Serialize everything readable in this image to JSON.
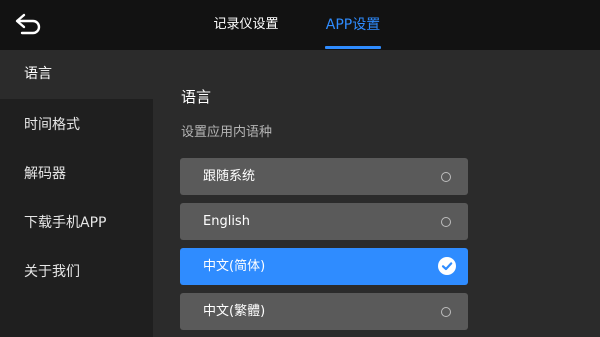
{
  "header": {
    "back_icon": "back-arrow-icon",
    "tabs": [
      {
        "label": "记录仪设置",
        "active": false
      },
      {
        "label": "APP设置",
        "active": true
      }
    ],
    "accent_color": "#2f8cff"
  },
  "sidebar": {
    "items": [
      {
        "label": "语言",
        "active": true
      },
      {
        "label": "时间格式",
        "active": false
      },
      {
        "label": "解码器",
        "active": false
      },
      {
        "label": "下载手机APP",
        "active": false
      },
      {
        "label": "关于我们",
        "active": false
      }
    ]
  },
  "main": {
    "title": "语言",
    "subtitle": "设置应用内语种",
    "options": [
      {
        "label": "跟随系统",
        "selected": false
      },
      {
        "label": "English",
        "selected": false
      },
      {
        "label": "中文(简体)",
        "selected": true
      },
      {
        "label": "中文(繁體)",
        "selected": false
      }
    ]
  }
}
